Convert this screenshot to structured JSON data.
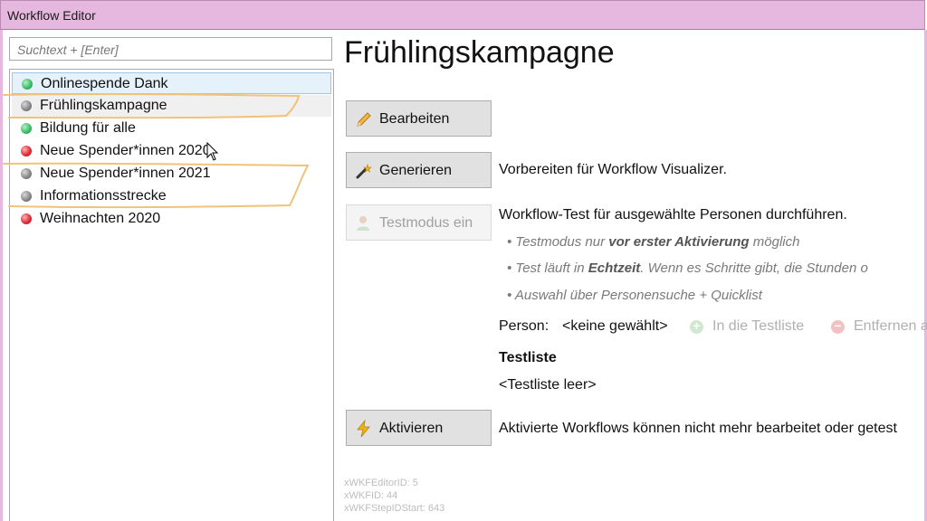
{
  "window": {
    "title": "Workflow Editor"
  },
  "search": {
    "placeholder": "Suchtext + [Enter]"
  },
  "workflows": [
    {
      "label": "Onlinespende Dank",
      "status": "green"
    },
    {
      "label": "Frühlingskampagne",
      "status": "gray"
    },
    {
      "label": "Bildung für alle",
      "status": "green"
    },
    {
      "label": "Neue Spender*innen 2020",
      "status": "red"
    },
    {
      "label": "Neue Spender*innen 2021",
      "status": "gray"
    },
    {
      "label": "Informationsstrecke",
      "status": "gray"
    },
    {
      "label": "Weihnachten 2020",
      "status": "red"
    }
  ],
  "detail": {
    "title": "Frühlingskampagne",
    "edit_button": "Bearbeiten",
    "generate_button": "Generieren",
    "generate_desc": "Vorbereiten für Workflow Visualizer.",
    "testmode_button": "Testmodus ein",
    "testmode_desc": "Workflow-Test für ausgewählte Personen durchführen.",
    "bullet1": {
      "pre": "• Testmodus nur ",
      "bold": "vor erster Aktivierung",
      "post": " möglich"
    },
    "bullet2": {
      "pre": "• Test läuft in ",
      "bold": "Echtzeit",
      "post": ". Wenn es Schritte gibt, die Stunden o"
    },
    "bullet3": "• Auswahl über Personensuche + Quicklist",
    "person_label": "Person:",
    "person_value": "<keine gewählt>",
    "add_to_testlist": "In die Testliste",
    "remove": "Entfernen a",
    "testlist_heading": "Testliste",
    "testlist_empty": "<Testliste leer>",
    "activate_button": "Aktivieren",
    "activate_desc": "Aktivierte Workflows können nicht mehr bearbeitet oder getest",
    "editor_id": "xWKFEditorID: 5",
    "wkf_id": "xWKFID: 44",
    "step_start": "xWKFStepIDStart: 643"
  },
  "colors": {
    "titlebar": "#e6b8df",
    "annotation": "#f0c27a",
    "status_green": "#3fbf6a",
    "status_gray": "#8a8a8a",
    "status_red": "#e0303a"
  }
}
